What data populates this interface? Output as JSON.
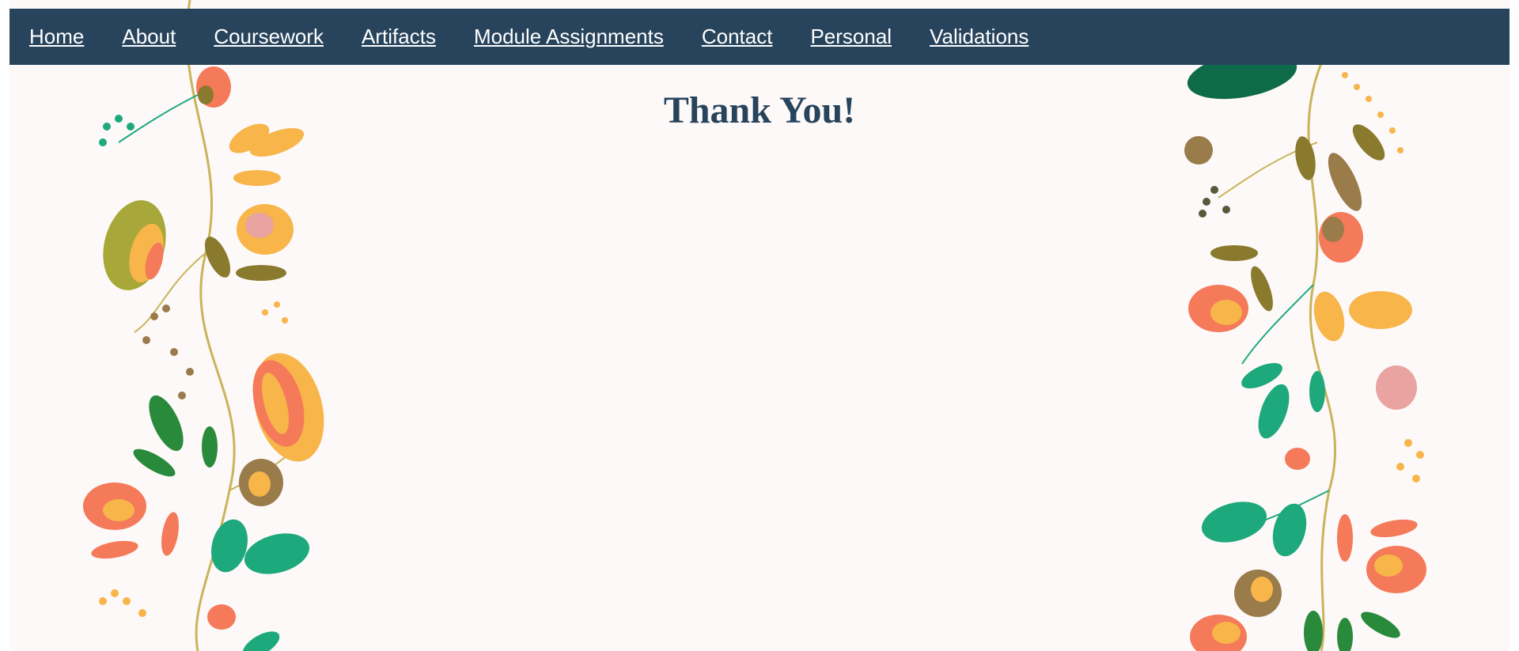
{
  "nav": {
    "items": [
      {
        "label": "Home"
      },
      {
        "label": "About"
      },
      {
        "label": "Coursework"
      },
      {
        "label": "Artifacts"
      },
      {
        "label": "Module Assignments"
      },
      {
        "label": "Contact"
      },
      {
        "label": "Personal"
      },
      {
        "label": "Validations"
      }
    ]
  },
  "main": {
    "title": "Thank You!"
  },
  "colors": {
    "nav_background": "#27445c",
    "title_text": "#27445c",
    "page_background": "#fdf9f9",
    "floral_palette": [
      "#f47a5a",
      "#f7b54a",
      "#1ea97c",
      "#8a7a2e",
      "#e9a3a0",
      "#2a8a3c",
      "#c9a84a"
    ]
  }
}
